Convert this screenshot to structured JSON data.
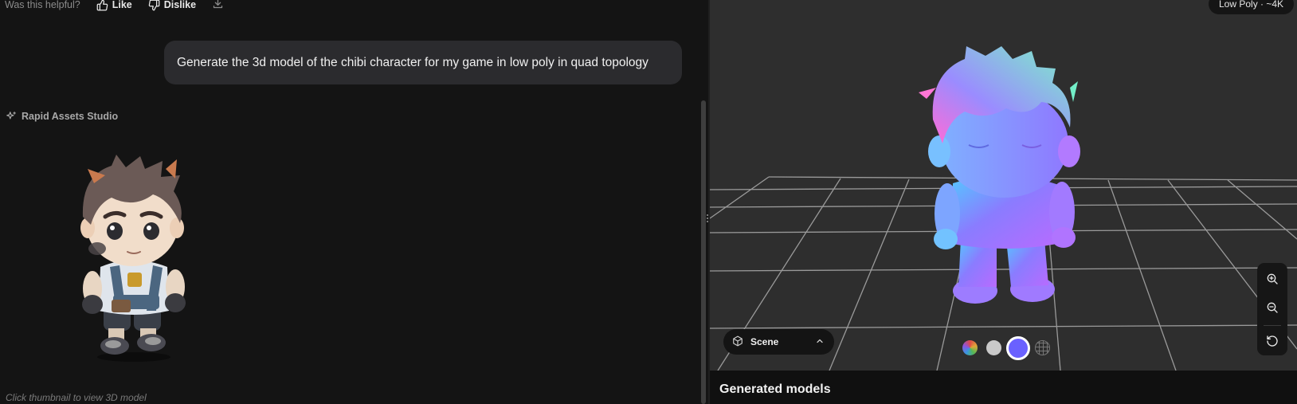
{
  "feedback": {
    "question": "Was this helpful?",
    "like_label": "Like",
    "dislike_label": "Dislike",
    "download_icon": "download-icon"
  },
  "chat": {
    "user_message": "Generate the 3d model of the chibi character for my game in low poly in quad topology",
    "assistant_name": "Rapid Assets Studio",
    "assistant_icon": "sparkle-icon",
    "thumbnail_hint": "Click thumbnail to view 3D model"
  },
  "viewer": {
    "quality_badge": "Low Poly · ~4K",
    "scene_label": "Scene",
    "zoom_in_icon": "zoom-in-icon",
    "zoom_out_icon": "zoom-out-icon",
    "reset_icon": "reset-view-icon",
    "materials": [
      "color",
      "clay",
      "normal",
      "wireframe"
    ],
    "active_material": "normal",
    "accent_color": "#6a61ff"
  },
  "generated": {
    "title": "Generated models"
  }
}
